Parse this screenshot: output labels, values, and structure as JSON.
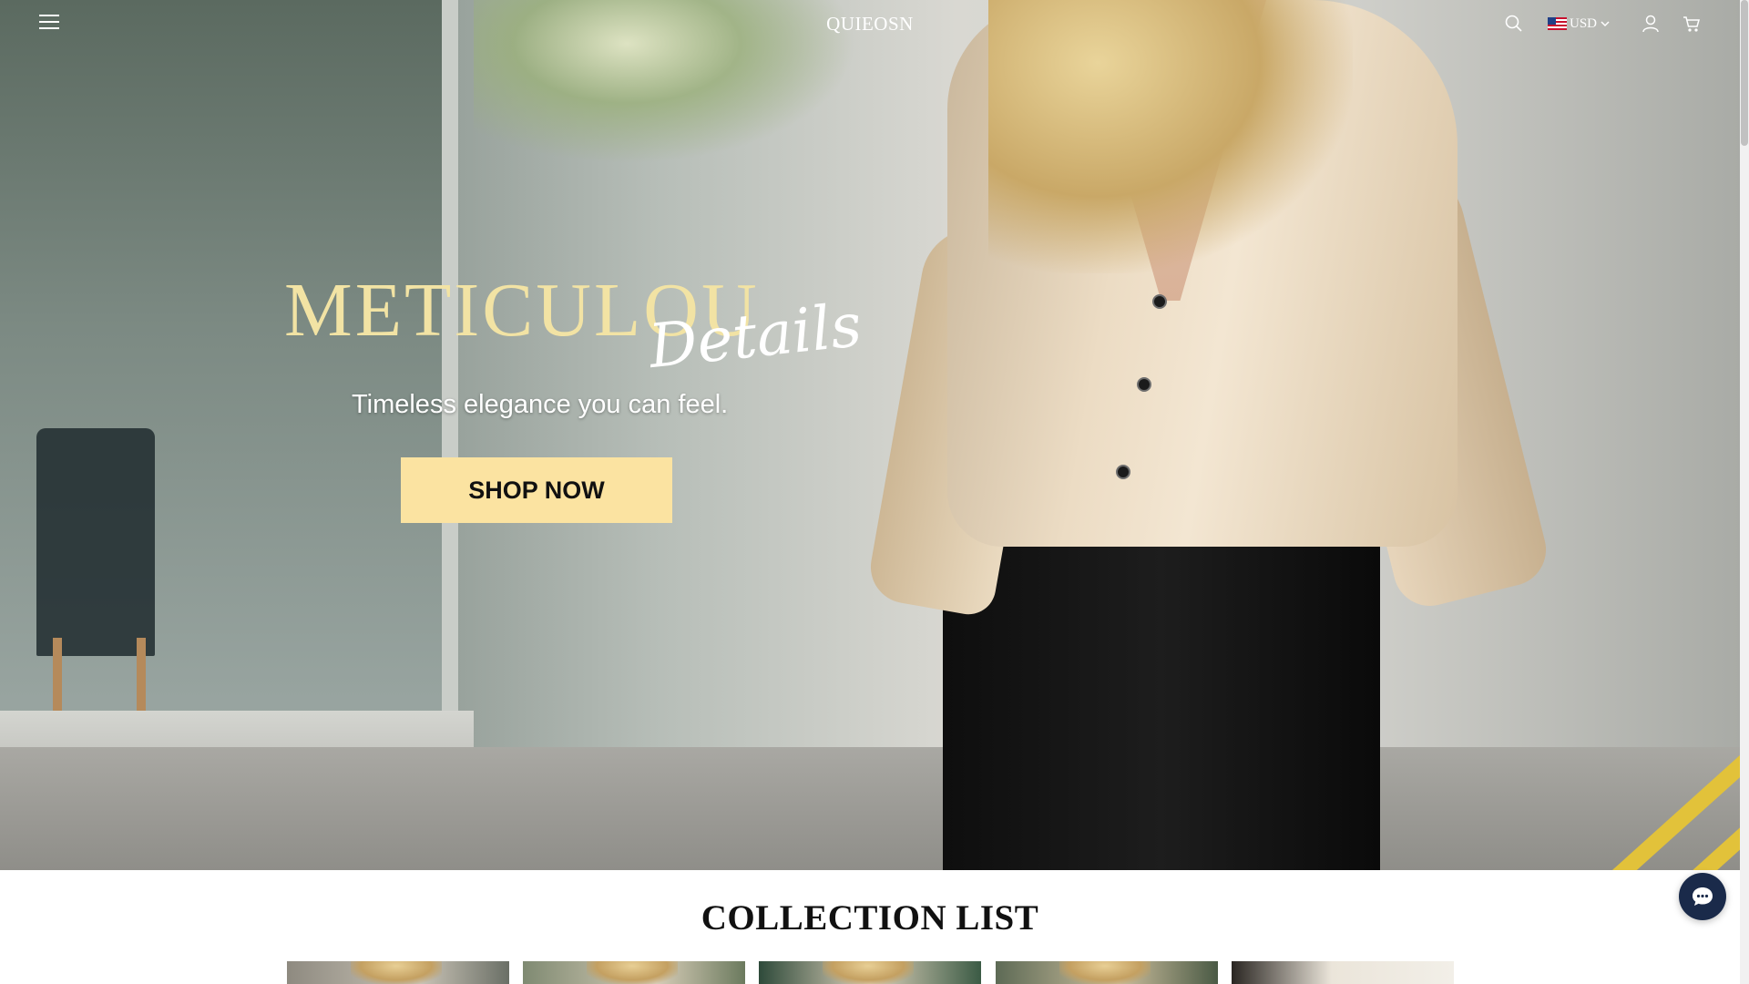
{
  "header": {
    "brand": "QUIEOSN",
    "currency": "USD",
    "icons": [
      "menu-icon",
      "search-icon",
      "us-flag-icon",
      "chevron-down-icon",
      "account-icon",
      "cart-icon"
    ]
  },
  "hero": {
    "title": "METICULOU",
    "script": "Details",
    "subtitle": "Timeless elegance you can feel.",
    "cta": "SHOP NOW"
  },
  "collection": {
    "title": "COLLECTION LIST",
    "thumbnails": 5
  },
  "chat": {
    "icon": "chat-bubble-icon"
  },
  "colors": {
    "cta_background": "#fbe3a1",
    "hero_title": "#f2e3a4",
    "chat_button": "#1a2a4a"
  }
}
